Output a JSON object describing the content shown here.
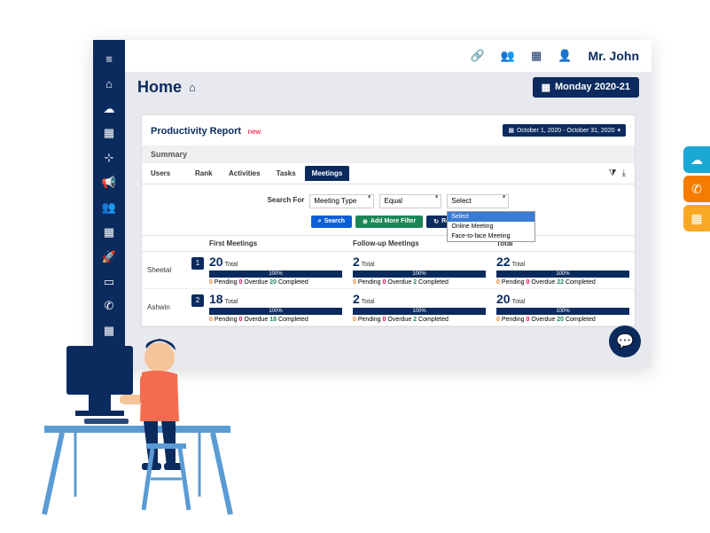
{
  "header": {
    "username": "Mr. John",
    "home_label": "Home",
    "date_badge": "Monday 2020-21"
  },
  "report": {
    "title": "Productivity Report",
    "new_tag": "new",
    "date_range": "October 1, 2020 - October 31, 2020",
    "summary_label": "Summary",
    "col_users": "Users",
    "col_rank": "Rank",
    "tabs": [
      "Activities",
      "Tasks",
      "Meetings"
    ],
    "search_label": "Search For",
    "select1": "Meeting Type",
    "select2": "Equal",
    "select3": "Select",
    "dropdown_options": [
      "Select",
      "Online Meeting",
      "Face-to-face Meeting"
    ],
    "btn_search": "Search",
    "btn_add": "Add More Filter",
    "btn_reset": "Reset",
    "col_first": "First Meetings",
    "col_followup": "Follow-up Meetings",
    "col_total": "Total",
    "progress": "100%",
    "status_pending": "Pending",
    "status_overdue": "Overdue",
    "status_completed": "Completed",
    "total_suffix": "Total"
  },
  "users": [
    {
      "name": "Sheetal",
      "rank": "1",
      "first": {
        "total": "20",
        "pending": "0",
        "overdue": "0",
        "completed": "20"
      },
      "followup": {
        "total": "2",
        "pending": "0",
        "overdue": "0",
        "completed": "2"
      },
      "total": {
        "total": "22",
        "pending": "0",
        "overdue": "0",
        "completed": "22"
      }
    },
    {
      "name": "Ashwin",
      "rank": "2",
      "first": {
        "total": "18",
        "pending": "0",
        "overdue": "0",
        "completed": "18"
      },
      "followup": {
        "total": "2",
        "pending": "0",
        "overdue": "0",
        "completed": "2"
      },
      "total": {
        "total": "20",
        "pending": "0",
        "overdue": "0",
        "completed": "20"
      }
    }
  ]
}
